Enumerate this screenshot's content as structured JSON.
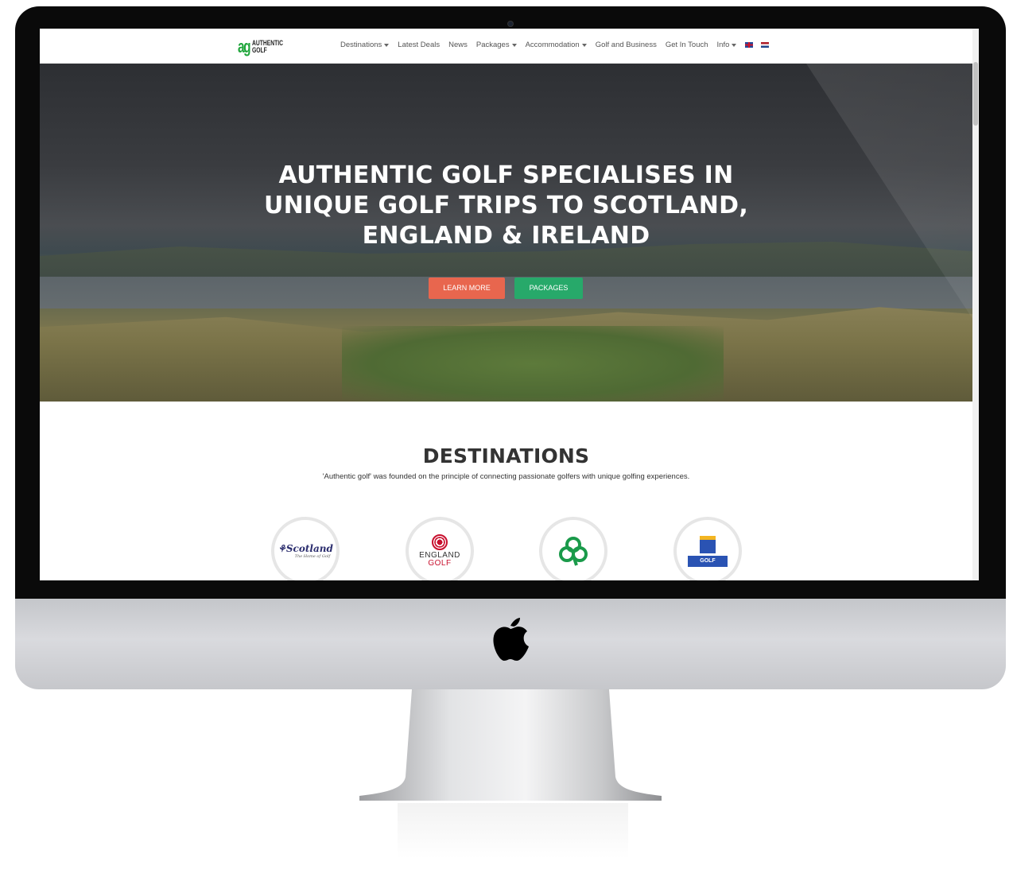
{
  "nav": {
    "logo_mark": "ag",
    "logo_line1": "AUTHENTIC",
    "logo_line2": "GOLF",
    "items": [
      {
        "label": "Destinations",
        "dropdown": true
      },
      {
        "label": "Latest Deals",
        "dropdown": false
      },
      {
        "label": "News",
        "dropdown": false
      },
      {
        "label": "Packages",
        "dropdown": true
      },
      {
        "label": "Accommodation",
        "dropdown": true
      },
      {
        "label": "Golf and Business",
        "dropdown": false
      },
      {
        "label": "Get In Touch",
        "dropdown": false
      },
      {
        "label": "Info",
        "dropdown": true
      }
    ],
    "flags": [
      "flag-uk-icon",
      "flag-nl-icon"
    ]
  },
  "hero": {
    "title_line1": "AUTHENTIC GOLF SPECIALISES IN",
    "title_line2": "UNIQUE GOLF TRIPS TO SCOTLAND,",
    "title_line3": "ENGLAND & IRELAND",
    "learn_more": "LEARN MORE",
    "packages": "PACKAGES"
  },
  "destinations": {
    "title": "DESTINATIONS",
    "subtitle": "'Authentic golf' was founded on the principle of connecting passionate golfers with unique golfing experiences.",
    "scotland": {
      "name": "Scotland",
      "tagline": "The Home of Golf"
    },
    "england": {
      "line1": "ENGLAND",
      "line2": "GOLF"
    },
    "ireland": {
      "icon": "shamrock-icon"
    },
    "france": {
      "badge": "GOLF"
    }
  },
  "colors": {
    "accent_green": "#27a96a",
    "accent_orange": "#e8664e",
    "logo_green": "#1fa53b"
  }
}
